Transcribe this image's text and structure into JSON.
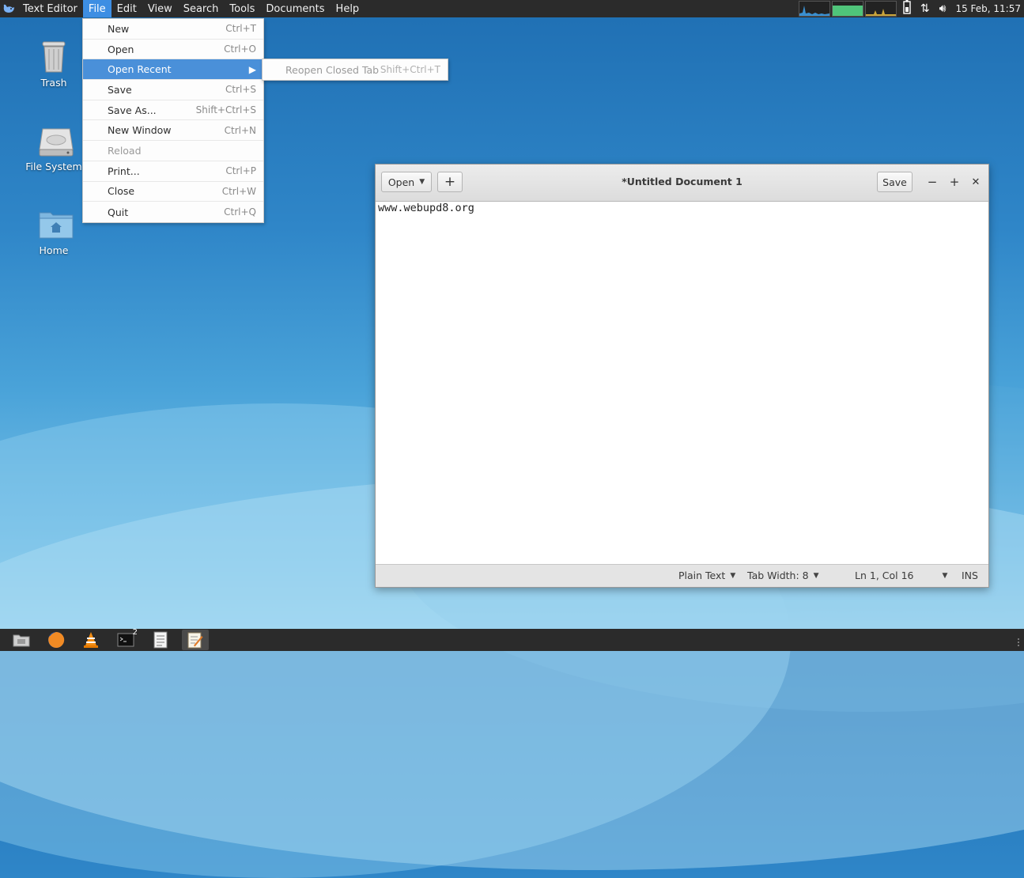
{
  "top_panel": {
    "app_name": "Text Editor",
    "menus": [
      "File",
      "Edit",
      "View",
      "Search",
      "Tools",
      "Documents",
      "Help"
    ],
    "clock": "15 Feb, 11:57"
  },
  "desktop": {
    "icons": [
      {
        "label": "Trash",
        "icon": "trash-icon"
      },
      {
        "label": "File System",
        "icon": "drive-icon"
      },
      {
        "label": "Home",
        "icon": "home-folder-icon"
      }
    ]
  },
  "file_menu": {
    "items": [
      {
        "label": "New",
        "accel": "Ctrl+T"
      },
      {
        "label": "Open",
        "accel": "Ctrl+O"
      },
      {
        "label": "Open Recent",
        "accel": ""
      },
      {
        "label": "Save",
        "accel": "Ctrl+S"
      },
      {
        "label": "Save As...",
        "accel": "Shift+Ctrl+S"
      },
      {
        "label": "New Window",
        "accel": "Ctrl+N"
      },
      {
        "label": "Reload",
        "accel": ""
      },
      {
        "label": "Print...",
        "accel": "Ctrl+P"
      },
      {
        "label": "Close",
        "accel": "Ctrl+W"
      },
      {
        "label": "Quit",
        "accel": "Ctrl+Q"
      }
    ],
    "highlighted": "Open Recent",
    "disabled": [
      "Reload"
    ]
  },
  "submenu": {
    "label": "Reopen Closed Tab",
    "accel": "Shift+Ctrl+T"
  },
  "window": {
    "open_label": "Open",
    "new_tab_label": "+",
    "title": "*Untitled Document 1",
    "save_label": "Save",
    "content": "www.webupd8.org"
  },
  "statusbar": {
    "language": "Plain Text",
    "tab_width": "Tab Width: 8",
    "position": "Ln 1, Col 16",
    "mode": "INS"
  },
  "taskbar": {
    "items": [
      "file-manager-icon",
      "firefox-icon",
      "vlc-icon",
      "terminal-icon",
      "text-document-icon",
      "text-editor-icon"
    ],
    "terminal_count": "2"
  },
  "colors": {
    "accent": "#4a90d9",
    "panel": "#2b2b2b"
  }
}
